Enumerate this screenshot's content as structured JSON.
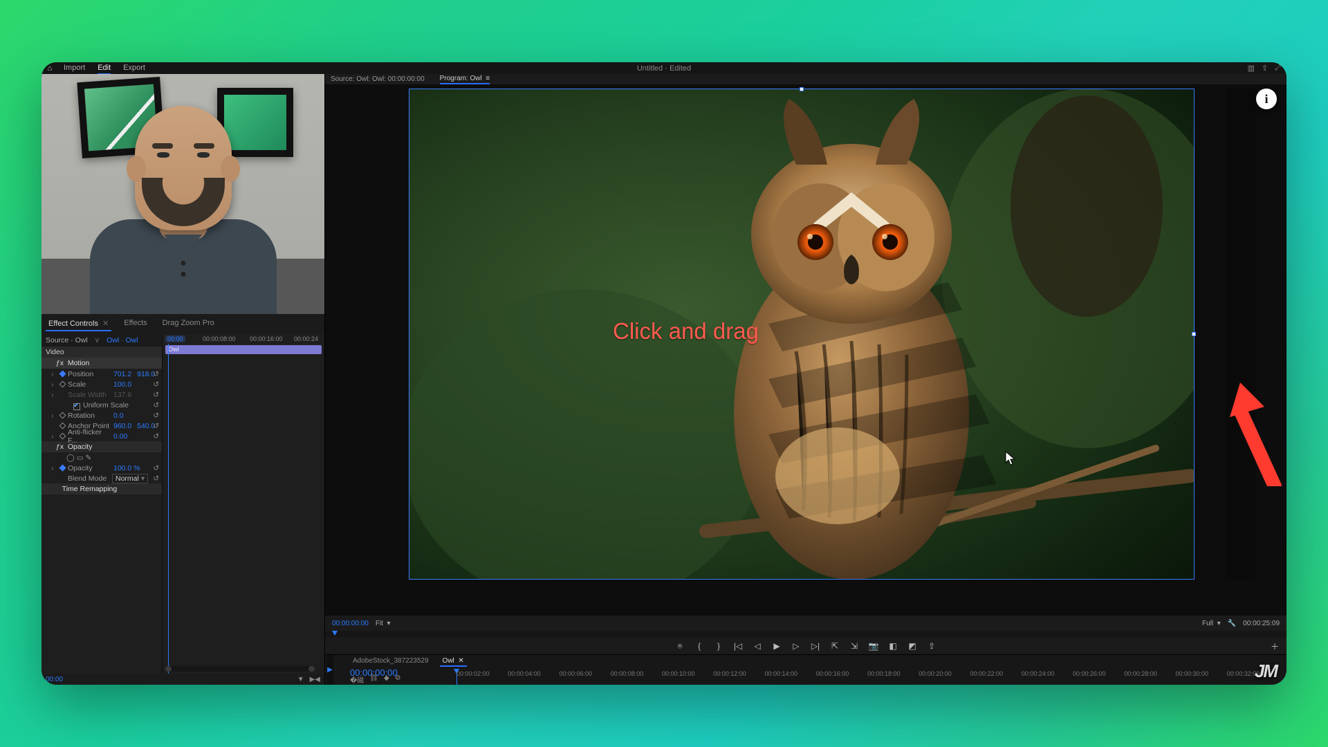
{
  "titlebar": {
    "tabs": [
      "Import",
      "Edit",
      "Export"
    ],
    "active_tab": "Edit",
    "project_title": "Untitled · Edited"
  },
  "panel_tabs": {
    "items": [
      "Effect Controls",
      "Effects",
      "Drag Zoom Pro"
    ],
    "active": "Effect Controls"
  },
  "fx": {
    "source_label": "Source · Owl",
    "clip_link": "Owl · Owl",
    "timecodes": [
      "00:00",
      "00:00:08:00",
      "00:00:16:00",
      "00:00:24"
    ],
    "clip_name": "Owl",
    "video_header": "Video",
    "motion": {
      "label": "Motion",
      "position": {
        "label": "Position",
        "x": "701.2",
        "y": "918.0"
      },
      "scale": {
        "label": "Scale",
        "value": "100.0"
      },
      "scale_width": {
        "label": "Scale Width",
        "value": "137.6"
      },
      "uniform": {
        "label": "Uniform Scale",
        "checked": true
      },
      "rotation": {
        "label": "Rotation",
        "value": "0.0"
      },
      "anchor": {
        "label": "Anchor Point",
        "x": "960.0",
        "y": "540.0"
      },
      "antiflicker": {
        "label": "Anti-flicker F...",
        "value": "0.00"
      }
    },
    "opacity": {
      "label": "Opacity",
      "value_label": "Opacity",
      "value": "100.0 %",
      "blend_label": "Blend Mode",
      "blend_value": "Normal"
    },
    "time_remap": "Time Remapping"
  },
  "leftfoot": {
    "timecode": "00:00"
  },
  "source_bar": {
    "source": "Source: Owl: Owl: 00:00:00:00",
    "program": "Program: Owl"
  },
  "overlay_text": "Click and drag",
  "program_controls": {
    "current_tc": "00:00:00:00",
    "fit": "Fit",
    "quality": "Full",
    "duration": "00:00:25:09"
  },
  "timeline": {
    "tabs": [
      "AdobeStock_387223529",
      "Owl"
    ],
    "active": "Owl",
    "timecode": "00:00:00:00",
    "ticks": [
      "00:00:02:00",
      "00:00:04:00",
      "00:00:06:00",
      "00:00:08:00",
      "00:00:10:00",
      "00:00:12:00",
      "00:00:14:00",
      "00:00:16:00",
      "00:00:18:00",
      "00:00:20:00",
      "00:00:22:00",
      "00:00:24:00",
      "00:00:26:00",
      "00:00:28:00",
      "00:00:30:00",
      "00:00:32:00"
    ]
  },
  "watermark": "JM",
  "info_badge": "i"
}
